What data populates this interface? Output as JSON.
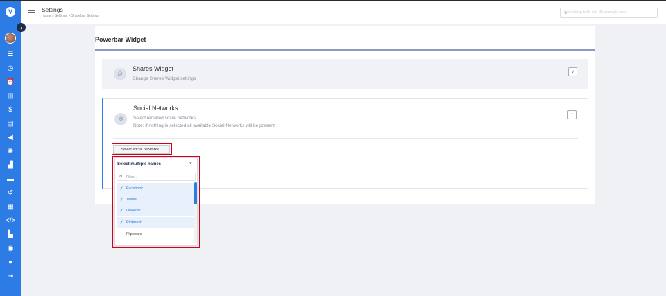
{
  "header": {
    "title": "Settings",
    "breadcrumb": "Home  >  Settings  >  Sharebar Settings",
    "site_select_value": "demo.blog-tech-site-01.example.com"
  },
  "panel": {
    "title": "Powerbar Widget"
  },
  "shares_widget": {
    "icon": "@",
    "title": "Shares Widget",
    "subtitle": "Change Shares Widget settings",
    "toggle": "v"
  },
  "social_networks": {
    "icon": "@",
    "title": "Social Networks",
    "subtitle": "Select required social networks",
    "note": "Note: if nothing is selected all available Social Networks will be present",
    "toggle": "^",
    "select_button": "Select social networks..."
  },
  "dropdown": {
    "title": "Select multiple names",
    "close": "×",
    "filter_placeholder": "Filter...",
    "options": [
      {
        "label": "Facebook",
        "selected": true
      },
      {
        "label": "Twitter",
        "selected": true
      },
      {
        "label": "Linkedin",
        "selected": true
      },
      {
        "label": "Pinterest",
        "selected": true
      },
      {
        "label": "Flipboard",
        "selected": false
      }
    ]
  },
  "colors": {
    "sidebar": "#2d7be5",
    "highlight": "#d0021b",
    "accent": "#2d7be5"
  },
  "sidebar_icons": [
    "list-icon",
    "clock-icon",
    "alarm-icon",
    "book-icon",
    "dollar-icon",
    "id-card-icon",
    "megaphone-icon",
    "gear-icon",
    "chart-icon",
    "card-icon",
    "history-icon",
    "widget-icon",
    "code-icon",
    "library-icon",
    "support-icon",
    "chat-icon",
    "logout-icon"
  ]
}
